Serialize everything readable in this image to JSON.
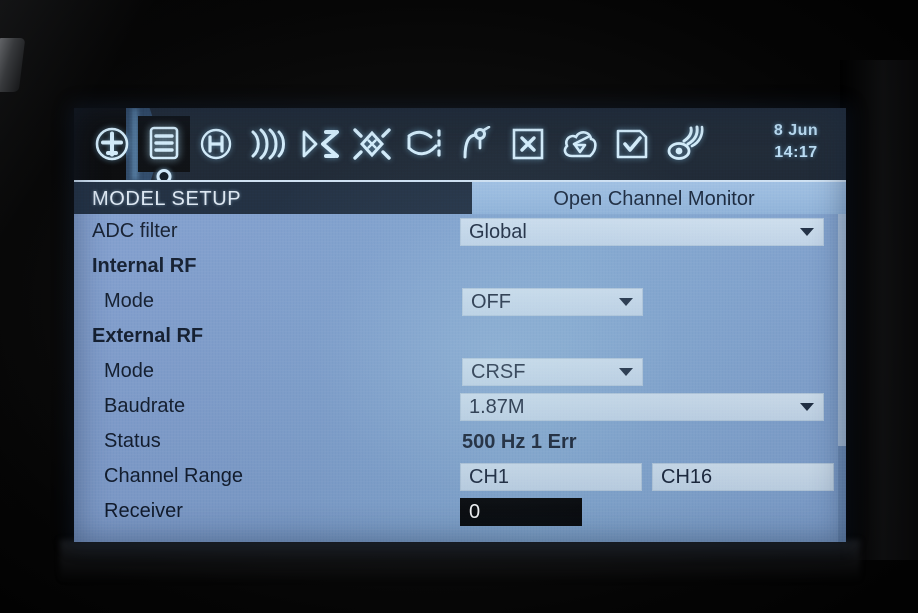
{
  "device": {
    "screen_background": "#7fa0ce",
    "toolbar_background": "#17222f",
    "title_bar_background": "#1b2a3d",
    "accent": "#cfe8fa"
  },
  "toolbar": {
    "icons": [
      {
        "name": "model-select-icon",
        "label": "Model Select"
      },
      {
        "name": "model-setup-icon",
        "label": "Model Setup",
        "selected": true
      },
      {
        "name": "heli-setup-icon",
        "label": "Heli Setup"
      },
      {
        "name": "flight-modes-icon",
        "label": "Flight Modes"
      },
      {
        "name": "inputs-icon",
        "label": "Inputs"
      },
      {
        "name": "mixer-icon",
        "label": "Mixer"
      },
      {
        "name": "outputs-curves-icon",
        "label": "Outputs"
      },
      {
        "name": "curves-icon",
        "label": "Curves"
      },
      {
        "name": "logical-switches-icon",
        "label": "Logical Switches"
      },
      {
        "name": "special-functions-icon",
        "label": "Special Functions"
      },
      {
        "name": "custom-scripts-icon",
        "label": "Custom Scripts"
      },
      {
        "name": "telemetry-icon",
        "label": "Telemetry"
      }
    ],
    "clock": {
      "date": "8 Jun",
      "time": "14:17"
    }
  },
  "title_bar": {
    "page_title": "MODEL SETUP",
    "action": "Open Channel Monitor"
  },
  "rows": [
    {
      "id": "adc-filter",
      "label": "ADC filter",
      "style": "item0",
      "control": "dropdown",
      "value": "Global"
    },
    {
      "id": "internal-rf",
      "label": "Internal RF",
      "style": "section",
      "control": "none",
      "value": ""
    },
    {
      "id": "internal-rf-mode",
      "label": "Mode",
      "style": "item",
      "control": "dropdown",
      "value": "OFF"
    },
    {
      "id": "external-rf",
      "label": "External RF",
      "style": "section",
      "control": "none",
      "value": ""
    },
    {
      "id": "external-rf-mode",
      "label": "Mode",
      "style": "item",
      "control": "dropdown",
      "value": "CRSF"
    },
    {
      "id": "baudrate",
      "label": "Baudrate",
      "style": "item",
      "control": "dropdown",
      "value": "1.87M"
    },
    {
      "id": "status",
      "label": "Status",
      "style": "item",
      "control": "text",
      "value": "500 Hz 1 Err"
    },
    {
      "id": "channel-range",
      "label": "Channel Range",
      "style": "item",
      "control": "range",
      "value_low": "CH1",
      "value_high": "CH16"
    },
    {
      "id": "receiver",
      "label": "Receiver",
      "style": "item",
      "control": "field-selected",
      "value": "0"
    }
  ]
}
